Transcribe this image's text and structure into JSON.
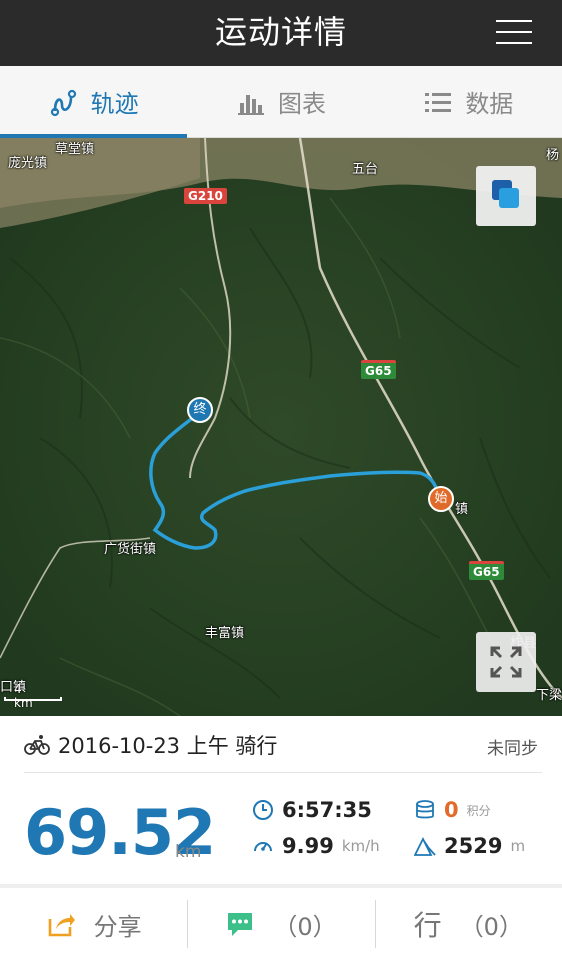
{
  "header": {
    "title": "运动详情",
    "menu_icon": "hamburger-menu-icon"
  },
  "tabs": [
    {
      "label": "轨迹",
      "icon": "track-route-icon",
      "active": true
    },
    {
      "label": "图表",
      "icon": "bar-chart-icon",
      "active": false
    },
    {
      "label": "数据",
      "icon": "list-icon",
      "active": false
    }
  ],
  "map": {
    "labels": {
      "pangguang": "庞光镇",
      "caotang": "草堂镇",
      "wutai": "五台",
      "yang": "杨",
      "guanghuo": "广货街镇",
      "fengfu": "丰富镇",
      "town_right": "镇",
      "county": "柞县",
      "xiaqu": "下梁",
      "kou": "口镇"
    },
    "shields": {
      "g210": "G210",
      "g65_a": "G65",
      "g65_b": "G65"
    },
    "marker_end": "终",
    "marker_start": "始",
    "scale": "4 km",
    "colors": {
      "track": "#2a9fd8",
      "marker_end": "#1f78b4",
      "marker_start": "#e06a2a"
    }
  },
  "activity": {
    "icon": "bicycle-icon",
    "date_label": "2016-10-23 上午 骑行",
    "sync_status": "未同步"
  },
  "stats": {
    "distance": "69.52",
    "distance_unit": "km",
    "duration": "6:57:35",
    "points": "0",
    "points_unit": "积分",
    "speed": "9.99",
    "speed_unit": "km/h",
    "elevation": "2529",
    "elevation_unit": "m"
  },
  "bottom": {
    "share_label": "分享",
    "comment_label": "（0）",
    "xing_char": "行",
    "xing_count": "（0）"
  }
}
